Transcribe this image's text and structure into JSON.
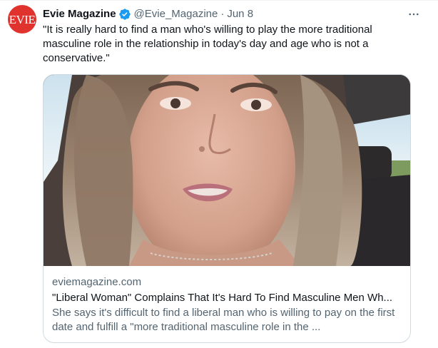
{
  "tweet": {
    "avatar_text": "EVIE",
    "author_name": "Evie Magazine",
    "handle": "@Evie_Magazine",
    "separator": "·",
    "date": "Jun 8",
    "text": "\"It is really hard to find a man who's willing to play the more traditional masculine role in the relationship in today's day and age who is not a conservative.\""
  },
  "card": {
    "domain": "eviemagazine.com",
    "title": "\"Liberal Woman\" Complains That It's Hard To Find Masculine Men Wh...",
    "description": "She says it's difficult to find a liberal man who is willing to pay on the first date and fulfill a \"more traditional masculine role in the ..."
  },
  "colors": {
    "avatar_bg": "#e0332e",
    "verified_badge": "#1d9bf0",
    "secondary_text": "#536471",
    "card_border": "#cfd9de"
  },
  "icons": {
    "verified": "verified-badge-icon",
    "more": "more-horizontal-icon"
  }
}
